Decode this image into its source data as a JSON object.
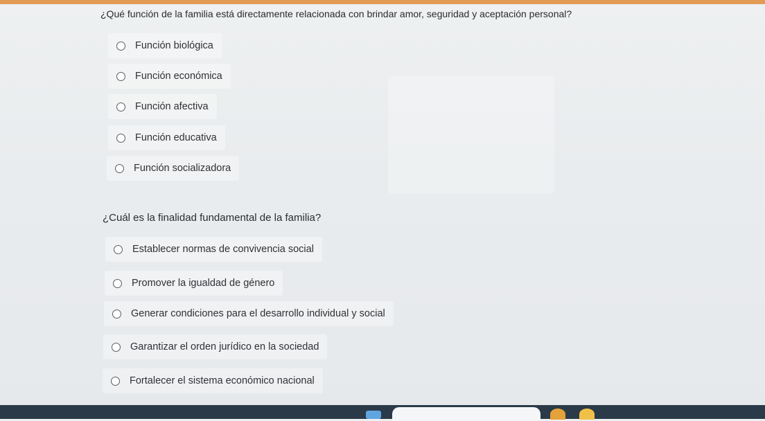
{
  "questions": [
    {
      "text": "¿Qué función de la familia está directamente relacionada con brindar amor, seguridad y aceptación personal?",
      "options": [
        "Función biológica",
        "Función económica",
        "Función afectiva",
        "Función educativa",
        "Función socializadora"
      ]
    },
    {
      "text": "¿Cuál es la finalidad fundamental de la familia?",
      "options": [
        "Establecer normas de convivencia social",
        "Promover la igualdad de género",
        "Generar condiciones para el desarrollo individual y social",
        "Garantizar el orden jurídico en la sociedad",
        "Fortalecer el sistema económico nacional"
      ]
    }
  ],
  "colors": {
    "accent_top": "#e39a55",
    "taskbar": "#2b3a48"
  }
}
